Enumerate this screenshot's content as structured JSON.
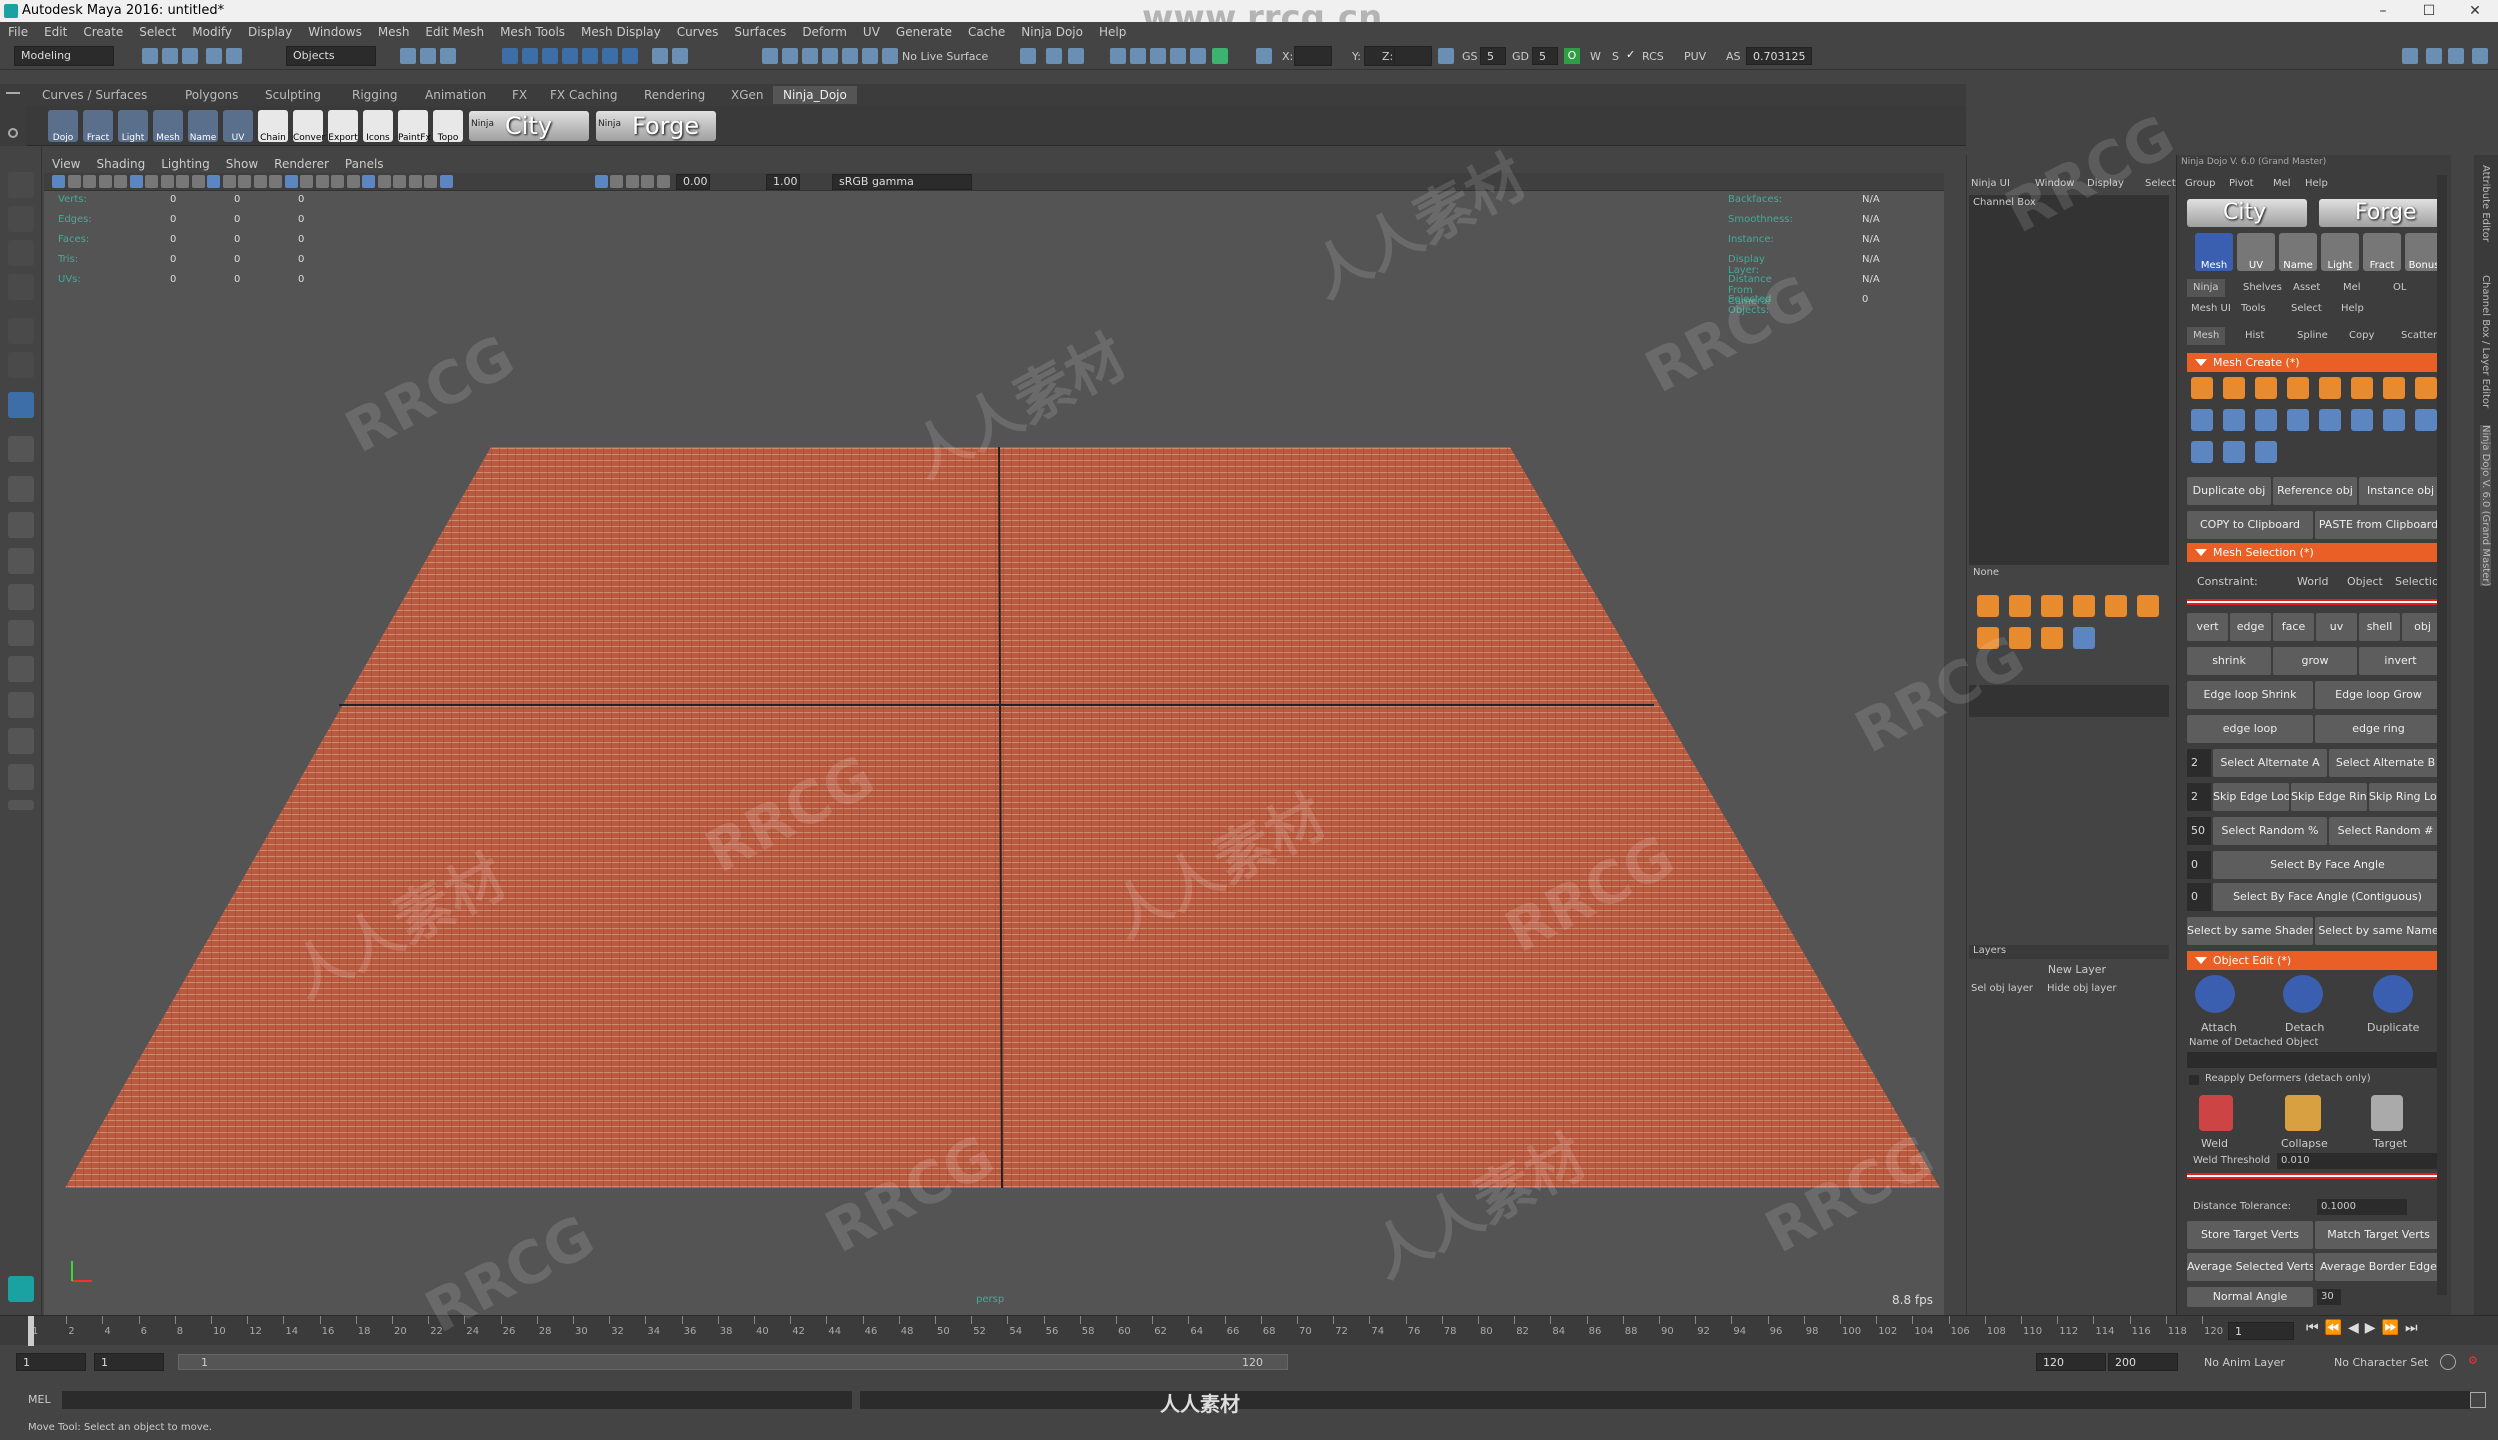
{
  "window": {
    "title": "Autodesk Maya 2016: untitled*",
    "minimize": "–",
    "maximize": "☐",
    "close": "✕"
  },
  "watermark_top": "www.rrcg.cn",
  "menu": [
    "File",
    "Edit",
    "Create",
    "Select",
    "Modify",
    "Display",
    "Windows",
    "Mesh",
    "Edit Mesh",
    "Mesh Tools",
    "Mesh Display",
    "Curves",
    "Surfaces",
    "Deform",
    "UV",
    "Generate",
    "Cache",
    "Ninja Dojo",
    "Help"
  ],
  "status": {
    "mode": "Modeling",
    "objects": "Objects",
    "live": "No Live Surface",
    "x": "X:",
    "y": "Y:",
    "z": "Z:",
    "gs_label": "GS",
    "gs": "5",
    "gd_label": "GD",
    "gd": "5",
    "o": "O",
    "w": "W",
    "s": "S",
    "rcs": "RCS",
    "puv": "PUV",
    "as": "AS",
    "as_val": "0.703125"
  },
  "shelf_tabs": [
    "Curves / Surfaces",
    "Polygons",
    "Sculpting",
    "Rigging",
    "Animation",
    "FX",
    "FX Caching",
    "Rendering",
    "XGen",
    "Ninja_Dojo"
  ],
  "shelf_buttons": [
    "Dojo",
    "Fract",
    "Light",
    "Mesh",
    "Name",
    "UV",
    "Chain",
    "Conver",
    "Export",
    "Icons",
    "PaintFx",
    "Topo"
  ],
  "shelf_big": {
    "city": "City",
    "forge": "Forge",
    "ninja": "Ninja"
  },
  "viewport": {
    "menu": [
      "View",
      "Shading",
      "Lighting",
      "Show",
      "Renderer",
      "Panels"
    ],
    "field1": "0.00",
    "field2": "1.00",
    "color_mgmt": "sRGB gamma",
    "hud_left": [
      {
        "label": "Verts:",
        "a": "0",
        "b": "0",
        "c": "0"
      },
      {
        "label": "Edges:",
        "a": "0",
        "b": "0",
        "c": "0"
      },
      {
        "label": "Faces:",
        "a": "0",
        "b": "0",
        "c": "0"
      },
      {
        "label": "Tris:",
        "a": "0",
        "b": "0",
        "c": "0"
      },
      {
        "label": "UVs:",
        "a": "0",
        "b": "0",
        "c": "0"
      }
    ],
    "hud_right": [
      {
        "label": "Backfaces:",
        "v": "N/A"
      },
      {
        "label": "Smoothness:",
        "v": "N/A"
      },
      {
        "label": "Instance:",
        "v": "N/A"
      },
      {
        "label": "Display Layer:",
        "v": "N/A"
      },
      {
        "label": "Distance From Camera:",
        "v": "N/A"
      },
      {
        "label": "Selected Objects:",
        "v": "0"
      }
    ],
    "camera": "persp",
    "fps": "8.8 fps",
    "plane_color": "#b5583e"
  },
  "channel_box": {
    "menu": [
      "Ninja UI",
      "Window",
      "Display",
      "Select"
    ],
    "title": "Channel Box",
    "none": "None",
    "layers": "Layers",
    "new_layer": "New Layer",
    "sel_obj_layer": "Sel obj layer",
    "hide_obj_layer": "Hide obj layer"
  },
  "ninja": {
    "version": "Ninja Dojo V. 6.0 (Grand Master)",
    "menu": [
      "Group",
      "Pivot",
      "Mel",
      "Help"
    ],
    "top_icons": [
      "Mesh",
      "UV",
      "Name",
      "Light",
      "Fract",
      "Bonus"
    ],
    "tabs1": [
      "Ninja",
      "Shelves",
      "Asset",
      "Mel",
      "OL"
    ],
    "menu2": [
      "Mesh UI",
      "Tools",
      "Select",
      "Help"
    ],
    "tabs2": [
      "Mesh",
      "Hist",
      "Spline",
      "Copy",
      "Scatter"
    ],
    "mesh_create": "Mesh Create (*)",
    "dup": "Duplicate obj",
    "ref": "Reference obj",
    "inst": "Instance obj",
    "copy": "COPY to Clipboard",
    "paste": "PASTE from Clipboard",
    "mesh_selection": "Mesh Selection (*)",
    "constraint": "Constraint:",
    "world": "World",
    "object": "Object",
    "selection": "Selection",
    "comps": [
      "vert",
      "edge",
      "face",
      "uv",
      "shell",
      "obj"
    ],
    "shrink": "shrink",
    "grow": "grow",
    "invert": "invert",
    "els": "Edge loop Shrink",
    "elg": "Edge loop Grow",
    "el": "edge loop",
    "er": "edge ring",
    "n1": "2",
    "sa": "Select Alternate A",
    "sb": "Select Alternate B",
    "n2": "2",
    "skl": "Skip Edge Loop",
    "skr": "Skip Edge Ring",
    "skrl": "Skip Ring Loop",
    "n3": "50",
    "rp": "Select Random %",
    "rn": "Select Random #",
    "n4": "0",
    "fa": "Select By Face Angle",
    "n5": "0",
    "fac": "Select By Face Angle (Contiguous)",
    "ss": "Select by same Shader",
    "sn": "Select by same Name",
    "object_edit": "Object Edit (*)",
    "attach": "Attach",
    "detach": "Detach",
    "duplicate": "Duplicate",
    "detached_name": "Name of Detached Object",
    "reapply": "Reapply Deformers (detach only)",
    "weld": "Weld",
    "collapse": "Collapse",
    "target": "Target",
    "weld_thr": "Weld Threshold",
    "weld_val": "0.010",
    "dist_tol": "Distance Tolerance:",
    "dist_val": "0.1000",
    "store": "Store Target Verts",
    "match": "Match Target Verts",
    "avg_sel": "Average Selected Verts",
    "avg_border": "Average Border Edge",
    "normal": "Normal Angle",
    "normal_val": "30"
  },
  "side_tabs": [
    "Attribute Editor",
    "Channel Box / Layer Editor",
    "Ninja Dojo V. 6.0 (Grand Master)"
  ],
  "timeline": {
    "start": "1",
    "end": "120",
    "current": "1",
    "ticks": [
      "1",
      "2",
      "4",
      "6",
      "8",
      "10",
      "12",
      "14",
      "16",
      "18",
      "20",
      "22",
      "24",
      "26",
      "28",
      "30",
      "32",
      "34",
      "36",
      "38",
      "40",
      "42",
      "44",
      "46",
      "48",
      "50",
      "52",
      "54",
      "56",
      "58",
      "60",
      "62",
      "64",
      "66",
      "68",
      "70",
      "72",
      "74",
      "76",
      "78",
      "80",
      "82",
      "84",
      "86",
      "88",
      "90",
      "92",
      "94",
      "96",
      "98",
      "100",
      "102",
      "104",
      "106",
      "108",
      "110",
      "112",
      "114",
      "116",
      "118",
      "120"
    ]
  },
  "range": {
    "a": "1",
    "b": "1",
    "c": "1",
    "d": "120",
    "e": "120",
    "f": "200",
    "anim_layer": "No Anim Layer",
    "char_set": "No Character Set"
  },
  "cmd": {
    "label": "MEL",
    "help": "Move Tool: Select an object to move."
  },
  "bottom_logo": "人人素材"
}
